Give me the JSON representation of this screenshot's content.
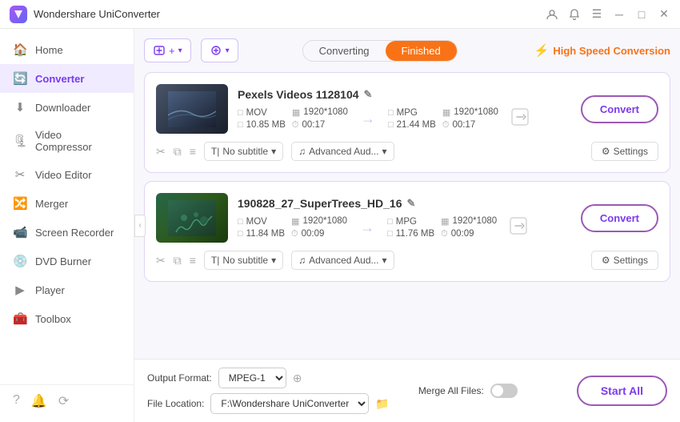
{
  "app": {
    "title": "Wondershare UniConverter",
    "logo_letter": "W"
  },
  "titlebar": {
    "controls": [
      "user-icon",
      "bell-icon",
      "menu-icon",
      "minimize-icon",
      "maximize-icon",
      "close-icon"
    ]
  },
  "sidebar": {
    "items": [
      {
        "id": "home",
        "label": "Home",
        "icon": "🏠"
      },
      {
        "id": "converter",
        "label": "Converter",
        "icon": "🔄",
        "active": true
      },
      {
        "id": "downloader",
        "label": "Downloader",
        "icon": "⬇"
      },
      {
        "id": "video-compressor",
        "label": "Video Compressor",
        "icon": "🗜"
      },
      {
        "id": "video-editor",
        "label": "Video Editor",
        "icon": "✂"
      },
      {
        "id": "merger",
        "label": "Merger",
        "icon": "🔀"
      },
      {
        "id": "screen-recorder",
        "label": "Screen Recorder",
        "icon": "📹"
      },
      {
        "id": "dvd-burner",
        "label": "DVD Burner",
        "icon": "💿"
      },
      {
        "id": "player",
        "label": "Player",
        "icon": "▶"
      },
      {
        "id": "toolbox",
        "label": "Toolbox",
        "icon": "🧰"
      }
    ],
    "footer_icons": [
      "question-icon",
      "bell-icon",
      "sync-icon"
    ]
  },
  "toolbar": {
    "add_button_label": "+",
    "settings_button_label": "+",
    "tab_converting": "Converting",
    "tab_finished": "Finished",
    "high_speed_label": "High Speed Conversion"
  },
  "files": [
    {
      "id": "file1",
      "title": "Pexels Videos 1128104",
      "input_format": "MOV",
      "input_resolution": "1920*1080",
      "input_size": "10.85 MB",
      "input_duration": "00:17",
      "output_format": "MPG",
      "output_resolution": "1920*1080",
      "output_size": "21.44 MB",
      "output_duration": "00:17",
      "subtitle": "No subtitle",
      "audio": "Advanced Aud...",
      "convert_label": "Convert",
      "settings_label": "Settings"
    },
    {
      "id": "file2",
      "title": "190828_27_SuperTrees_HD_16",
      "input_format": "MOV",
      "input_resolution": "1920*1080",
      "input_size": "11.84 MB",
      "input_duration": "00:09",
      "output_format": "MPG",
      "output_resolution": "1920*1080",
      "output_size": "11.76 MB",
      "output_duration": "00:09",
      "subtitle": "No subtitle",
      "audio": "Advanced Aud...",
      "convert_label": "Convert",
      "settings_label": "Settings"
    }
  ],
  "bottom": {
    "output_format_label": "Output Format:",
    "output_format_value": "MPEG-1",
    "file_location_label": "File Location:",
    "file_location_value": "F:\\Wondershare UniConverter",
    "merge_label": "Merge All Files:",
    "start_all_label": "Start All"
  }
}
